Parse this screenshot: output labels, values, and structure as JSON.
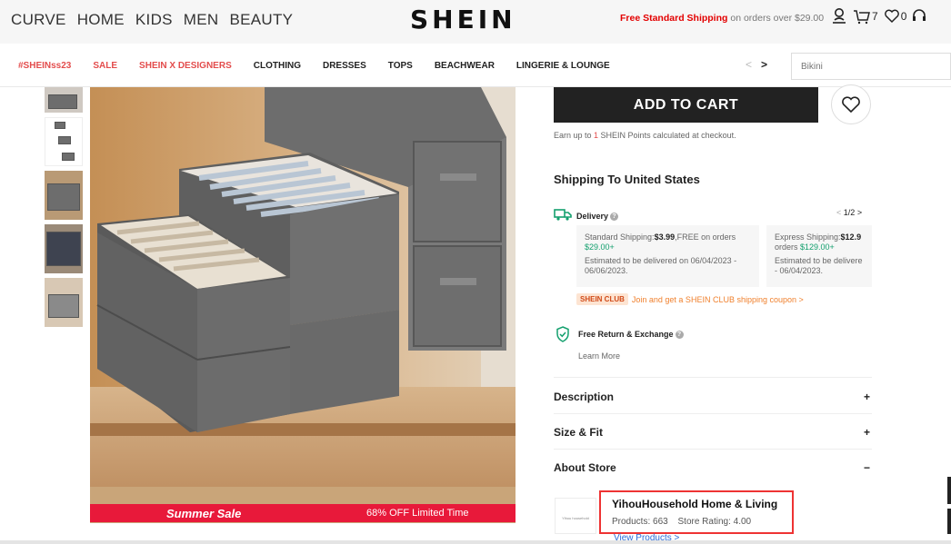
{
  "header": {
    "categories": [
      "CURVE",
      "HOME",
      "KIDS",
      "MEN",
      "BEAUTY"
    ],
    "logo": "SHEIN",
    "promo_bold": "Free Standard Shipping",
    "promo_rest": "on orders over $29.00",
    "cart_count": "7",
    "wishlist_count": "0"
  },
  "nav": {
    "links": [
      "#SHEINss23",
      "SALE",
      "SHEIN X DESIGNERS",
      "CLOTHING",
      "DRESSES",
      "TOPS",
      "BEACHWEAR",
      "LINGERIE & LOUNGE"
    ],
    "prev_arrow": "<",
    "next_arrow": ">",
    "search_placeholder": "Bikini"
  },
  "banner": {
    "left": "Summer Sale",
    "right": "68% OFF Limited Time"
  },
  "product": {
    "add_to_cart": "ADD TO CART",
    "points_pre": "Earn up to ",
    "points_num": "1",
    "points_post": " SHEIN Points calculated at checkout."
  },
  "shipping": {
    "title": "Shipping To United States",
    "delivery_label": "Delivery",
    "pager": "1/2",
    "standard": {
      "label": "Standard Shipping:",
      "price": "$3.99",
      "free_pre": ",FREE on orders ",
      "free_amt": "$29.00+",
      "eta": "Estimated to be delivered on 06/04/2023 - 06/06/2023."
    },
    "express": {
      "label": "Express Shipping:",
      "price": "$12.9",
      "free_pre": "orders ",
      "free_amt": "$129.00+",
      "eta": "Estimated to be delivere - 06/04/2023."
    },
    "club_badge": "SHEIN CLUB",
    "club_text": "Join and get a SHEIN CLUB shipping coupon >",
    "return_label": "Free Return & Exchange",
    "learn_more": "Learn More"
  },
  "sections": [
    {
      "label": "Description",
      "sign": "+"
    },
    {
      "label": "Size & Fit",
      "sign": "+"
    },
    {
      "label": "About Store",
      "sign": "−"
    }
  ],
  "store": {
    "logo_text": "Yihou household",
    "name": "YihouHousehold Home & Living",
    "products": "Products: 663",
    "rating": "Store Rating: 4.00",
    "view_products": "View Products >"
  },
  "colors": {
    "accent_red": "#e34c4c",
    "green": "#14a06e",
    "highlight_border": "#e33"
  }
}
